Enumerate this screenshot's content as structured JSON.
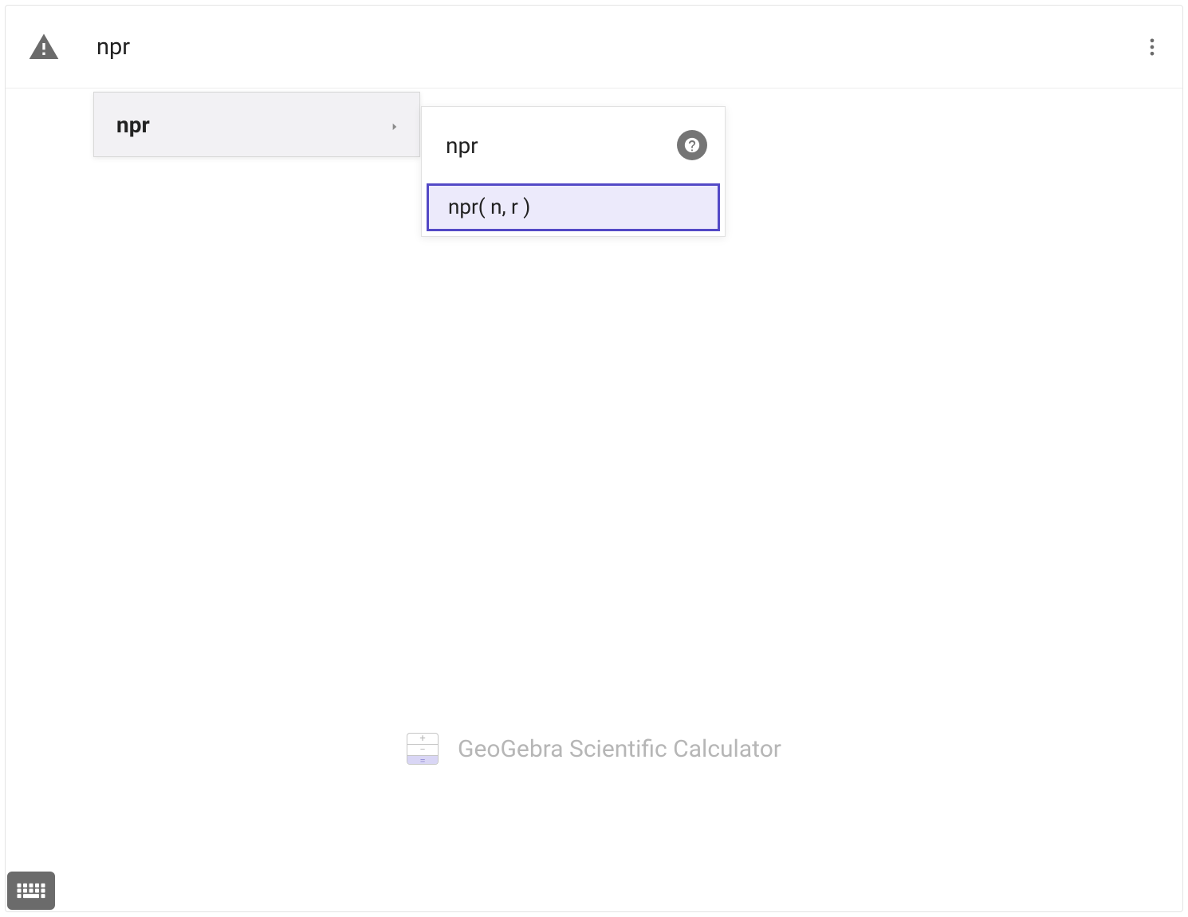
{
  "input": {
    "value": "npr"
  },
  "autocomplete": {
    "items": [
      {
        "label": "npr"
      }
    ]
  },
  "submenu": {
    "title": "npr",
    "options": [
      {
        "label": "npr( n, r )"
      }
    ]
  },
  "footer": {
    "brand": "GeoGebra Scientific Calculator"
  }
}
